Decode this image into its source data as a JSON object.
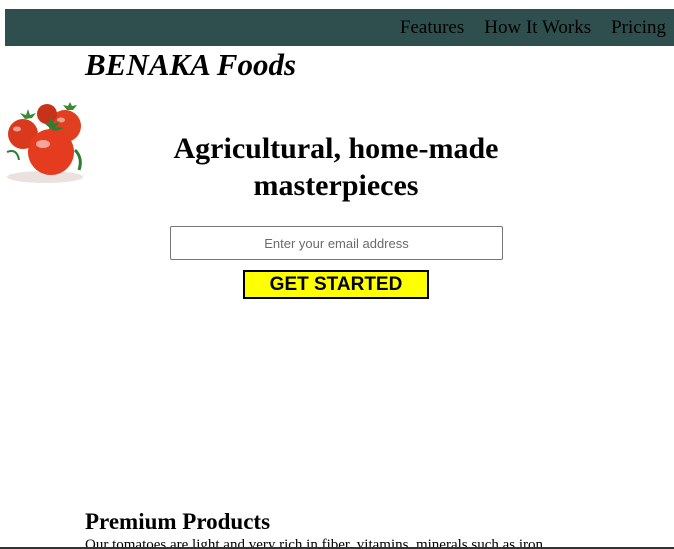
{
  "header": {
    "nav": [
      {
        "label": "Features"
      },
      {
        "label": "How It Works"
      },
      {
        "label": "Pricing"
      }
    ],
    "brand": "BENAKA Foods",
    "logo_icon": "tomato-logo-icon"
  },
  "hero": {
    "headline": "Agricultural, home-made masterpieces",
    "email_placeholder": "Enter your email address",
    "email_value": "",
    "cta_label": "GET STARTED"
  },
  "features": {
    "title": "Premium Products",
    "body": "Our tomatoes are light and very rich in fiber, vitamins, minerals such as iron"
  },
  "colors": {
    "navbar": "#2f4f4f",
    "cta_background": "#ffff00",
    "tomato": "#e53b1f",
    "leaf": "#2f7d32"
  }
}
